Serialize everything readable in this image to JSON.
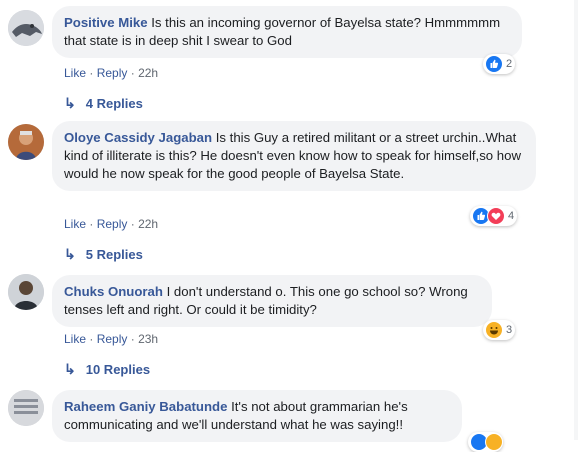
{
  "comments": [
    {
      "author": "Positive Mike",
      "text": "Is this an incoming governor of Bayelsa state? Hmmmmmm that state is in deep shit I swear to God",
      "like": "Like",
      "reply": "Reply",
      "time": "22h",
      "reaction_count": "2",
      "reaction_icons": [
        "like-reaction-icon"
      ],
      "replies_label": "4 Replies"
    },
    {
      "author": "Oloye Cassidy Jagaban",
      "text": "Is this Guy a retired militant or a street urchin..What kind of illiterate is this? He doesn't even know how to speak for himself,so how would he now speak for the good people of Bayelsa State.",
      "like": "Like",
      "reply": "Reply",
      "time": "22h",
      "reaction_count": "4",
      "reaction_icons": [
        "like-reaction-icon",
        "love-reaction-icon"
      ],
      "replies_label": "5 Replies"
    },
    {
      "author": "Chuks Onuorah",
      "text": "I don't understand o. This one go school so? Wrong tenses left and right. Or could it be timidity?",
      "like": "Like",
      "reply": "Reply",
      "time": "23h",
      "reaction_count": "3",
      "reaction_icons": [
        "haha-reaction-icon"
      ],
      "replies_label": "10 Replies"
    },
    {
      "author": "Raheem Ganiy Babatunde",
      "text": "It's not about grammarian he's communicating and we'll understand what he was saying!!"
    }
  ],
  "colors": {
    "link": "#385898",
    "bubble": "#f2f3f5",
    "meta": "#606770",
    "like_blue": "#1877f2",
    "love_red": "#f33e58",
    "haha_yellow": "#f7b125"
  }
}
